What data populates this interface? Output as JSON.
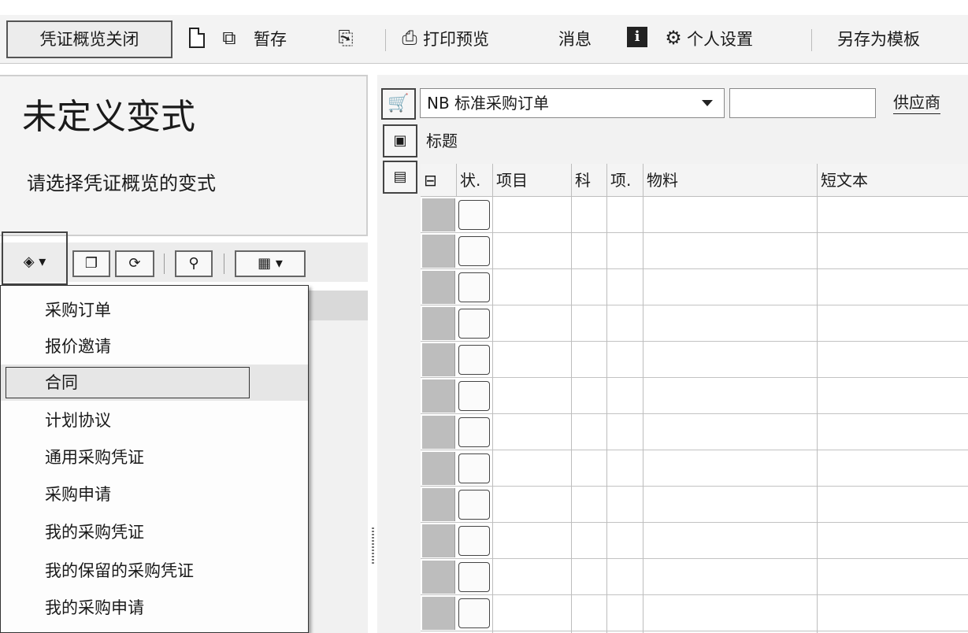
{
  "toolbar": {
    "close_label": "凭证概览关闭",
    "hold_label": "暂存",
    "print_preview_label": "打印预览",
    "messages_label": "消息",
    "personal_settings_label": "个人设置",
    "save_as_template_label": "另存为模板",
    "icons": [
      "new-document-icon",
      "copy-document-icon",
      "hold-icon",
      "print-preview-icon",
      "info-icon",
      "personal-settings-icon"
    ]
  },
  "left_panel": {
    "title": "未定义变式",
    "hint": "请选择凭证概览的变式",
    "tool_icons": [
      "selection-variant-icon",
      "copy-icon",
      "refresh-icon",
      "find-icon",
      "layout-icon"
    ]
  },
  "menu": {
    "items": [
      {
        "label": "采购订单"
      },
      {
        "label": "报价邀请"
      },
      {
        "label": "合同"
      },
      {
        "label": "计划协议"
      },
      {
        "label": "通用采购凭证"
      },
      {
        "label": "采购申请"
      },
      {
        "label": "我的采购凭证"
      },
      {
        "label": "我的保留的采购凭证"
      },
      {
        "label": "我的采购申请"
      }
    ],
    "highlighted_index": 2
  },
  "document": {
    "type_value": "NB 标准采购订单",
    "number_value": "",
    "vendor_label": "供应商",
    "header_label": "标题"
  },
  "grid": {
    "columns": [
      "",
      "状.",
      "项目",
      "科",
      "项.",
      "物料",
      "短文本"
    ],
    "row_count": 12
  }
}
